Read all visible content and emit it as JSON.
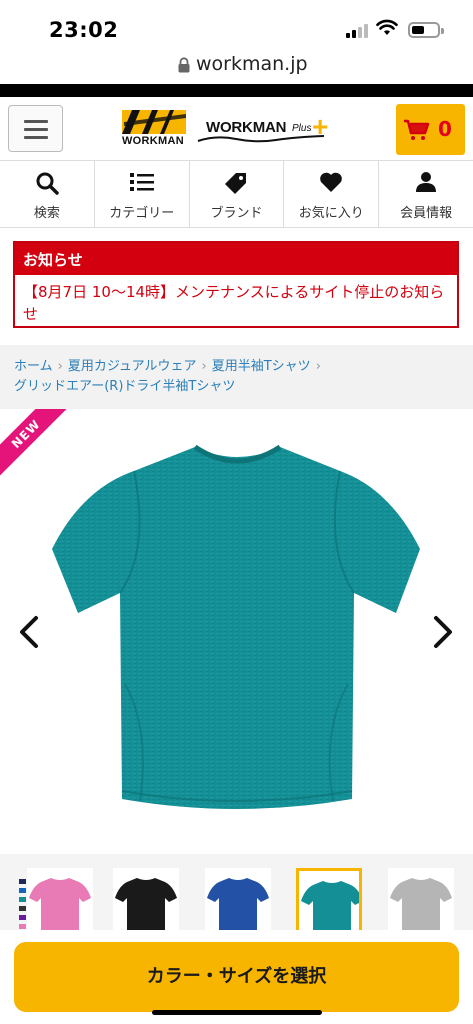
{
  "status_bar": {
    "time": "23:02"
  },
  "browser": {
    "domain": "workman.jp"
  },
  "header": {
    "logo_main": "WORKMAN",
    "logo_plus_text": "WORKMAN",
    "logo_plus_suffix": "Plus",
    "cart_count": "0",
    "brand_color": "#f7b500"
  },
  "nav": {
    "items": [
      {
        "label": "検索",
        "icon": "search-icon"
      },
      {
        "label": "カテゴリー",
        "icon": "list-icon"
      },
      {
        "label": "ブランド",
        "icon": "tag-icon"
      },
      {
        "label": "お気に入り",
        "icon": "heart-icon"
      },
      {
        "label": "会員情報",
        "icon": "user-icon"
      }
    ]
  },
  "notice": {
    "title": "お知らせ",
    "message": "【8月7日 10〜14時】メンテナンスによるサイト停止のお知らせ",
    "color": "#d3000f"
  },
  "breadcrumb": {
    "items": [
      "ホーム",
      "夏用カジュアルウェア",
      "夏用半袖Tシャツ"
    ],
    "current": "グリッドエアー(R)ドライ半袖Tシャツ"
  },
  "product": {
    "badge": "NEW",
    "image_color": "#138f95",
    "thumbnails": [
      {
        "color": "#e87bb5",
        "selected": false
      },
      {
        "color": "#1a1a1a",
        "selected": false
      },
      {
        "color": "#2251a6",
        "selected": false
      },
      {
        "color": "#138f95",
        "selected": true
      },
      {
        "color": "#b5b5b5",
        "selected": false
      }
    ],
    "swatches": [
      "#1d2a5a",
      "#1565c0",
      "#138f95",
      "#333333",
      "#6a1b9a",
      "#e87bb5"
    ]
  },
  "cta": {
    "label": "カラー・サイズを選択"
  }
}
